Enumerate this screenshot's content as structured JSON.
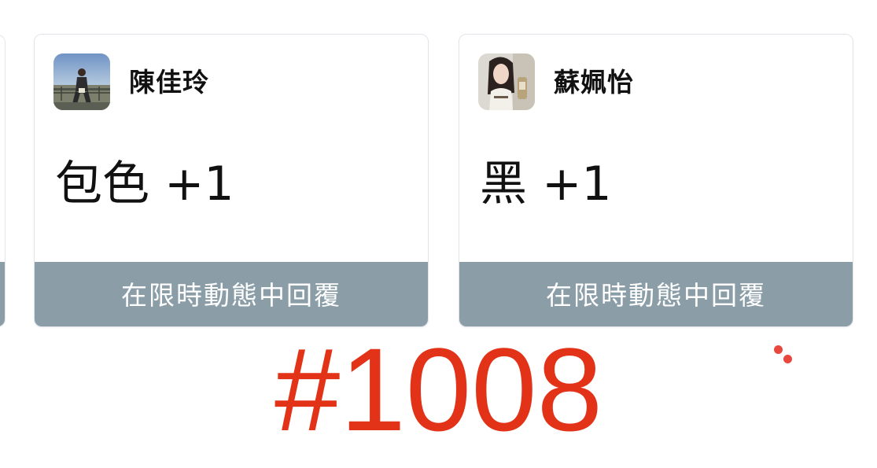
{
  "cards": [
    {
      "name": "陳佳玲",
      "reaction": "包色 +1",
      "reply_label": "在限時動態中回覆",
      "avatar": "avatar-photo"
    },
    {
      "name": "蘇姵怡",
      "reaction": "黑 +1",
      "reply_label": "在限時動態中回覆",
      "avatar": "avatar-photo"
    }
  ],
  "overlay_number": "#1008",
  "colors": {
    "reply_bar": "#8b9ea8",
    "number": "#e23217",
    "dots": "#e8473d"
  }
}
